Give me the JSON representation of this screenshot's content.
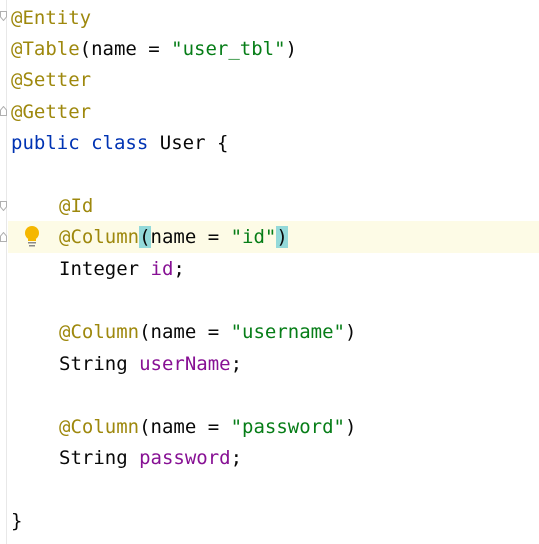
{
  "code": {
    "line1_annotation": "@Entity",
    "line2_annotation": "@Table",
    "line2_open": "(name = ",
    "line2_string": "\"user_tbl\"",
    "line2_close": ")",
    "line3_annotation": "@Setter",
    "line4_annotation": "@Getter",
    "line5_kw1": "public",
    "line5_kw2": "class",
    "line5_name": "User {",
    "line7_annotation": "@Id",
    "line8_annotation": "@Column",
    "line8_open_paren": "(",
    "line8_mid": "name = ",
    "line8_string": "\"id\"",
    "line8_close_paren": ")",
    "line9_type": "Integer",
    "line9_field": "id",
    "line9_semi": ";",
    "line11_annotation": "@Column",
    "line11_open": "(name = ",
    "line11_string": "\"username\"",
    "line11_close": ")",
    "line12_type": "String",
    "line12_field": "userName",
    "line12_semi": ";",
    "line14_annotation": "@Column",
    "line14_open": "(name = ",
    "line14_string": "\"password\"",
    "line14_close": ")",
    "line15_type": "String",
    "line15_field": "password",
    "line15_semi": ";",
    "line17_brace": "}"
  },
  "colors": {
    "annotation": "#9e880d",
    "keyword": "#0033b3",
    "string": "#067d17",
    "field": "#871094",
    "brace_match": "#93d9d9",
    "caret_row": "#fdfbe6",
    "bulb": "#f5b700"
  },
  "icons": {
    "intention": "lightbulb-icon",
    "fold": "fold-marker-icon"
  }
}
